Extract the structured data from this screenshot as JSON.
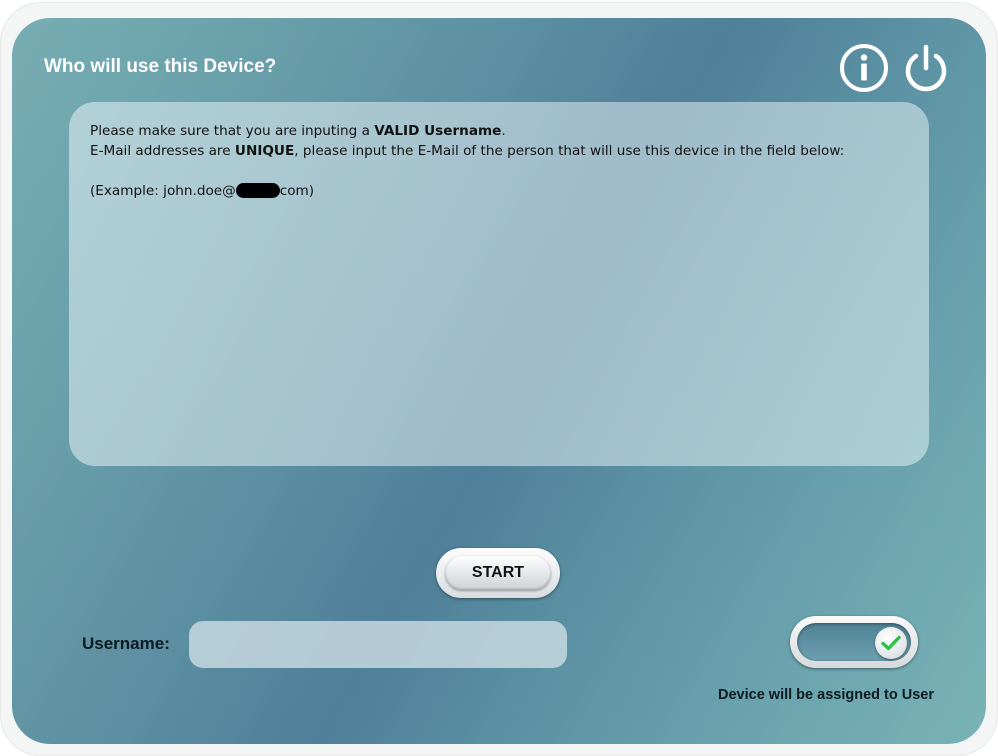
{
  "header": {
    "title": "Who will use this Device?",
    "info_icon": "info-circle-icon",
    "power_icon": "power-icon"
  },
  "message": {
    "line1_prefix": "Please make sure that you are inputing a ",
    "line1_bold": "VALID Username",
    "line1_suffix": ".",
    "line2_prefix": "E-Mail addresses are ",
    "line2_bold": "UNIQUE",
    "line2_suffix": ", please input the E-Mail of the person that will use this device in the field below:",
    "example_prefix": "(Example: john.doe@",
    "example_suffix": "com)"
  },
  "actions": {
    "start_label": "START"
  },
  "form": {
    "username_label": "Username:",
    "username_value": "",
    "username_placeholder": ""
  },
  "assign_toggle": {
    "state": "on",
    "label": "Device will be assigned to User",
    "check_icon": "check-icon",
    "check_color": "#2fbf4a"
  }
}
